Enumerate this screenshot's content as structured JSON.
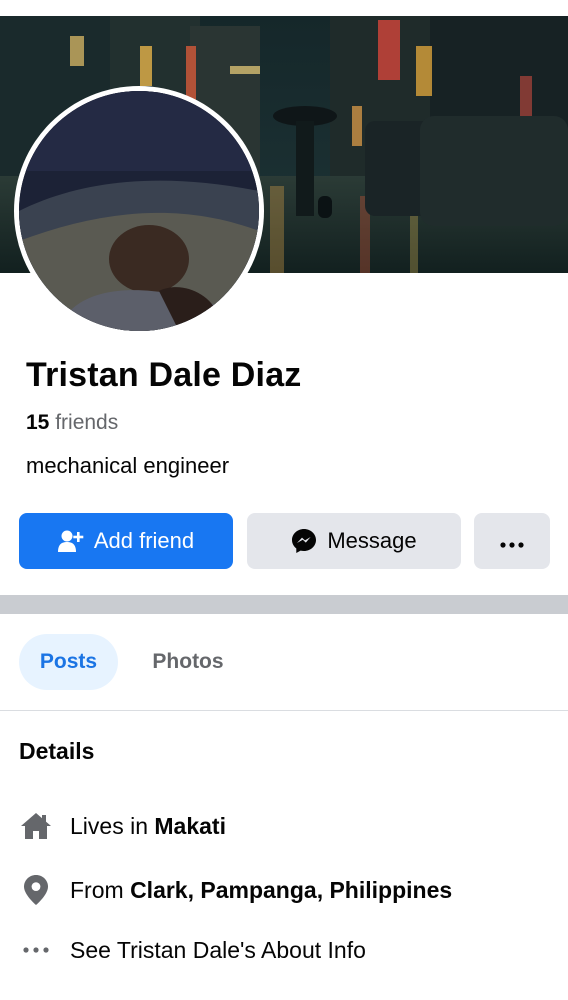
{
  "profile": {
    "name": "Tristan Dale Diaz",
    "friends_count": "15",
    "friends_label": "friends",
    "bio": "mechanical engineer"
  },
  "actions": {
    "add_friend": "Add friend",
    "message": "Message",
    "more": "..."
  },
  "tabs": [
    {
      "label": "Posts",
      "active": true
    },
    {
      "label": "Photos",
      "active": false
    }
  ],
  "details": {
    "title": "Details",
    "lives_prefix": "Lives in ",
    "lives_place": "Makati",
    "from_prefix": "From ",
    "from_place": "Clark, Pampanga, Philippines",
    "about_link": "See Tristan Dale's About Info"
  },
  "colors": {
    "primary": "#1877f2",
    "tab_active_bg": "#e7f3ff",
    "tab_active_text": "#1b74e4",
    "secondary_text": "#65676b",
    "button_gray": "#e4e6eb"
  },
  "icons": {
    "add_friend": "person-add-icon",
    "message": "messenger-icon",
    "more": "more-dots-icon",
    "home": "home-icon",
    "location": "location-pin-icon",
    "about": "ellipsis-icon"
  }
}
